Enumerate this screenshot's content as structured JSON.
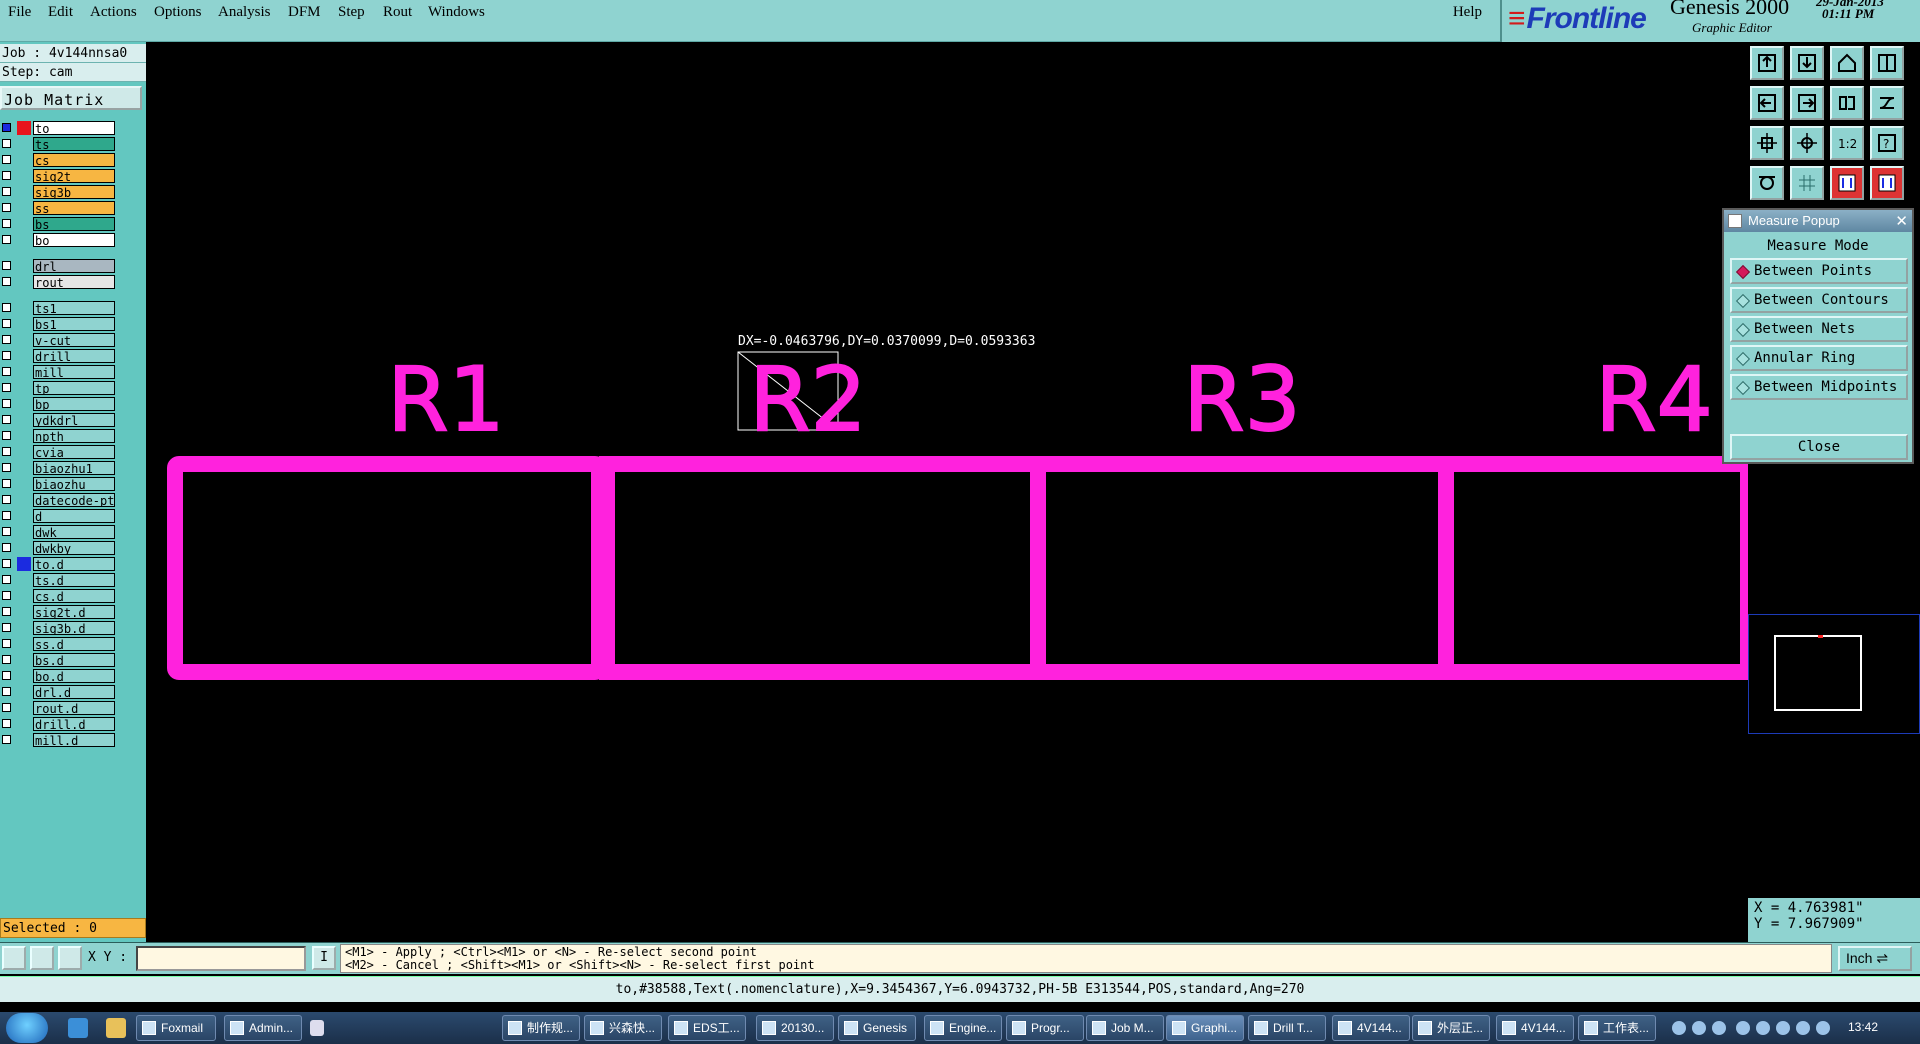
{
  "menu": [
    "File",
    "Edit",
    "Actions",
    "Options",
    "Analysis",
    "DFM",
    "Step",
    "Rout",
    "Windows"
  ],
  "help": "Help",
  "brand": {
    "logo": "Frontline",
    "product": "Genesis 2000",
    "subtitle": "Graphic Editor",
    "date": "29-Jan-2013",
    "time": "01:11 PM"
  },
  "job": "Job : 4v144nnsa0",
  "step": "Step: cam",
  "job_matrix": "Job Matrix ...",
  "layers_group1": [
    {
      "name": "to",
      "color": "#ffffff",
      "swatch": "#e8141c",
      "checked": true,
      "mark": "▪"
    },
    {
      "name": "ts",
      "color": "#2fa88c",
      "swatch": "",
      "mark": ""
    },
    {
      "name": "cs",
      "color": "#f7b642",
      "swatch": "",
      "mark": ""
    },
    {
      "name": "sig2t",
      "color": "#f7b642",
      "swatch": "",
      "mark": "⬋"
    },
    {
      "name": "sig3b",
      "color": "#f7b642",
      "swatch": "",
      "mark": "⬋"
    },
    {
      "name": "ss",
      "color": "#f7b642",
      "swatch": "",
      "mark": ""
    },
    {
      "name": "bs",
      "color": "#2fa88c",
      "swatch": "",
      "mark": ""
    },
    {
      "name": "bo",
      "color": "#ffffff",
      "swatch": "",
      "mark": ""
    }
  ],
  "layers_group2": [
    {
      "name": "drl",
      "color": "#a9b7c1",
      "swatch": "",
      "mark": ""
    },
    {
      "name": "rout",
      "color": "#e6e6e6",
      "swatch": "",
      "mark": ""
    }
  ],
  "layers_group3": [
    {
      "name": "ts1",
      "color": "#8fd3d0",
      "swatch": "",
      "mark": ""
    },
    {
      "name": "bs1",
      "color": "#8fd3d0",
      "swatch": "",
      "mark": ""
    },
    {
      "name": "v-cut",
      "color": "#8fd3d0",
      "swatch": "",
      "mark": ""
    },
    {
      "name": "drill",
      "color": "#8fd3d0",
      "swatch": "",
      "mark": ""
    },
    {
      "name": "mill",
      "color": "#8fd3d0",
      "swatch": "",
      "mark": ""
    },
    {
      "name": "tp",
      "color": "#8fd3d0",
      "swatch": "",
      "mark": ""
    },
    {
      "name": "bp",
      "color": "#8fd3d0",
      "swatch": "",
      "mark": ""
    },
    {
      "name": "ydkdrl",
      "color": "#8fd3d0",
      "swatch": "",
      "mark": ""
    },
    {
      "name": "npth",
      "color": "#8fd3d0",
      "swatch": "",
      "mark": ""
    },
    {
      "name": "cvia",
      "color": "#8fd3d0",
      "swatch": "",
      "mark": ""
    },
    {
      "name": "biaozhu1",
      "color": "#8fd3d0",
      "swatch": "",
      "mark": ""
    },
    {
      "name": "biaozhu",
      "color": "#8fd3d0",
      "swatch": "",
      "mark": ""
    },
    {
      "name": "datecode-pt",
      "color": "#8fd3d0",
      "swatch": "",
      "mark": ""
    },
    {
      "name": "d",
      "color": "#8fd3d0",
      "swatch": "",
      "mark": ""
    },
    {
      "name": "dwk",
      "color": "#8fd3d0",
      "swatch": "",
      "mark": ""
    },
    {
      "name": "dwkby",
      "color": "#8fd3d0",
      "swatch": "",
      "mark": ""
    },
    {
      "name": "to.d",
      "color": "#8fd3d0",
      "swatch": "#1b2be0",
      "mark": ""
    },
    {
      "name": "ts.d",
      "color": "#8fd3d0",
      "swatch": "",
      "mark": ""
    },
    {
      "name": "cs.d",
      "color": "#8fd3d0",
      "swatch": "",
      "mark": ""
    },
    {
      "name": "sig2t.d",
      "color": "#8fd3d0",
      "swatch": "",
      "mark": "⬋"
    },
    {
      "name": "sig3b.d",
      "color": "#8fd3d0",
      "swatch": "",
      "mark": "⬋"
    },
    {
      "name": "ss.d",
      "color": "#8fd3d0",
      "swatch": "",
      "mark": ""
    },
    {
      "name": "bs.d",
      "color": "#8fd3d0",
      "swatch": "",
      "mark": ""
    },
    {
      "name": "bo.d",
      "color": "#8fd3d0",
      "swatch": "",
      "mark": ""
    },
    {
      "name": "drl.d",
      "color": "#8fd3d0",
      "swatch": "",
      "mark": ""
    },
    {
      "name": "rout.d",
      "color": "#8fd3d0",
      "swatch": "",
      "mark": ""
    },
    {
      "name": "drill.d",
      "color": "#8fd3d0",
      "swatch": "",
      "mark": ""
    },
    {
      "name": "mill.d",
      "color": "#8fd3d0",
      "swatch": "",
      "mark": ""
    }
  ],
  "selected": "Selected : 0",
  "canvas": {
    "measure_text": "DX=-0.0463796,DY=0.0370099,D=0.0593363",
    "labels": [
      "R1",
      "R2",
      "R3",
      "R4"
    ],
    "color": "#ff22dd"
  },
  "measure_popup": {
    "title": "Measure Popup",
    "mode_label": "Measure Mode",
    "options": [
      "Between Points",
      "Between Contours",
      "Between Nets",
      "Annular Ring",
      "Between Midpoints"
    ],
    "selected_index": 0,
    "close": "Close"
  },
  "coords": {
    "x": "X = 4.763981\"",
    "y": "Y = 7.967909\""
  },
  "cmd": {
    "xy_label": "X Y :",
    "xy_value": "",
    "info": "I",
    "hint1": "<M1> - Apply  ; <Ctrl><M1> or <N> - Re-select second point",
    "hint2": "<M2> - Cancel ; <Shift><M1> or <Shift><N> - Re-select first point",
    "unit": "Inch"
  },
  "status": "to,#38588,Text(.nomenclature),X=9.3454367,Y=6.0943732,PH-5B E313544,POS,standard,Ang=270",
  "taskbar": {
    "tasks": [
      "Foxmail",
      "Admin...",
      "制作规...",
      "兴森快...",
      "EDS工...",
      "20130...",
      "Genesis",
      "Engine...",
      "Progr...",
      "Job M...",
      "Graphi...",
      "Drill T...",
      "4V144...",
      "外层正...",
      "4V144...",
      "工作表..."
    ],
    "active_index": 10,
    "clock": "13:42"
  }
}
